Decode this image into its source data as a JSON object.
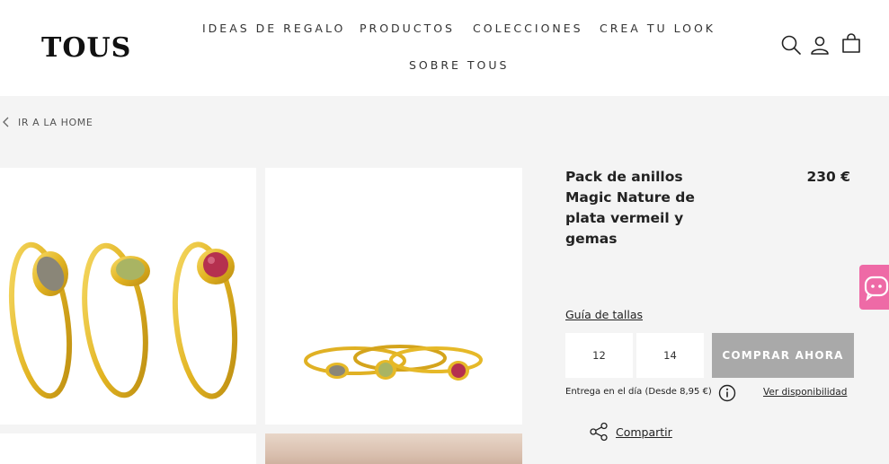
{
  "brand": {
    "logo_text": "TOUS"
  },
  "nav": {
    "items": [
      {
        "label": "IDEAS DE REGALO"
      },
      {
        "label": "PRODUCTOS"
      },
      {
        "label": "COLECCIONES"
      },
      {
        "label": "CREA TU LOOK"
      },
      {
        "label": "SOBRE TOUS"
      }
    ]
  },
  "header_icons": [
    "search-icon",
    "user-icon",
    "shopping-bag-icon"
  ],
  "breadcrumb": {
    "label": "IR A LA HOME"
  },
  "product": {
    "title": "Pack de anillos Magic Nature de plata vermeil y gemas",
    "price": "230 €",
    "size_guide": "Guía de tallas",
    "sizes": [
      "12",
      "14"
    ],
    "buy_label": "COMPRAR AHORA",
    "delivery_text": "Entrega en el día (Desde 8,95 €)",
    "availability_link": "Ver disponibilidad",
    "share_label": "Compartir"
  },
  "colors": {
    "buy_button": "#a9a9a9",
    "chat_tab": "#ee6aa6",
    "gold": "#e6b928",
    "gem_labradorite": "#8a8678",
    "gem_peridot": "#a9b463",
    "gem_rhodolite": "#b5304f"
  }
}
